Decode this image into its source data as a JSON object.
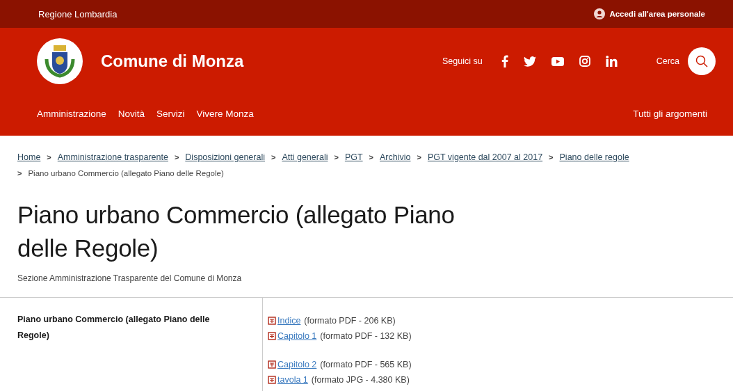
{
  "top_bar": {
    "region": "Regione Lombardia",
    "login": "Accedi all'area personale"
  },
  "header": {
    "site_name": "Comune di Monza",
    "follow_label": "Seguici su",
    "social": [
      {
        "kind": "facebook"
      },
      {
        "kind": "twitter"
      },
      {
        "kind": "youtube"
      },
      {
        "kind": "instagram"
      },
      {
        "kind": "linkedin"
      }
    ],
    "search_label": "Cerca"
  },
  "nav": {
    "items": [
      "Amministrazione",
      "Novità",
      "Servizi",
      "Vivere Monza"
    ],
    "all_topics": "Tutti gli argomenti"
  },
  "breadcrumb": [
    {
      "label": "Home",
      "link": true
    },
    {
      "separator": ">",
      "label": "Amministrazione trasparente",
      "link": true
    },
    {
      "separator": ">",
      "label": "Disposizioni generali",
      "link": true
    },
    {
      "separator": ">",
      "label": "Atti generali",
      "link": true
    },
    {
      "separator": ">",
      "label": "PGT",
      "link": true
    },
    {
      "separator": ">",
      "label": "Archivio",
      "link": true
    },
    {
      "separator": ">",
      "label": "PGT vigente dal 2007 al 2017",
      "link": true
    },
    {
      "separator": ">",
      "label": "Piano delle regole",
      "link": true
    },
    {
      "separator": ">",
      "label": "Piano urbano Commercio (allegato Piano delle Regole)",
      "link": false
    }
  ],
  "title": "Piano urbano Commercio (allegato Piano delle Regole)",
  "subtitle": "Sezione Amministrazione Trasparente del Comune di Monza",
  "table": {
    "label": "Piano urbano Commercio (allegato Piano delle Regole)",
    "groups": [
      [
        {
          "link": "Indice",
          "info": "(formato PDF - 206 KB)"
        },
        {
          "link": "Capitolo 1",
          "info": "(formato PDF - 132 KB)"
        }
      ],
      [
        {
          "link": "Capitolo 2",
          "info": "(formato PDF - 565 KB)"
        },
        {
          "link": "tavola 1",
          "info": "(formato JPG - 4.380 KB)"
        }
      ]
    ]
  }
}
